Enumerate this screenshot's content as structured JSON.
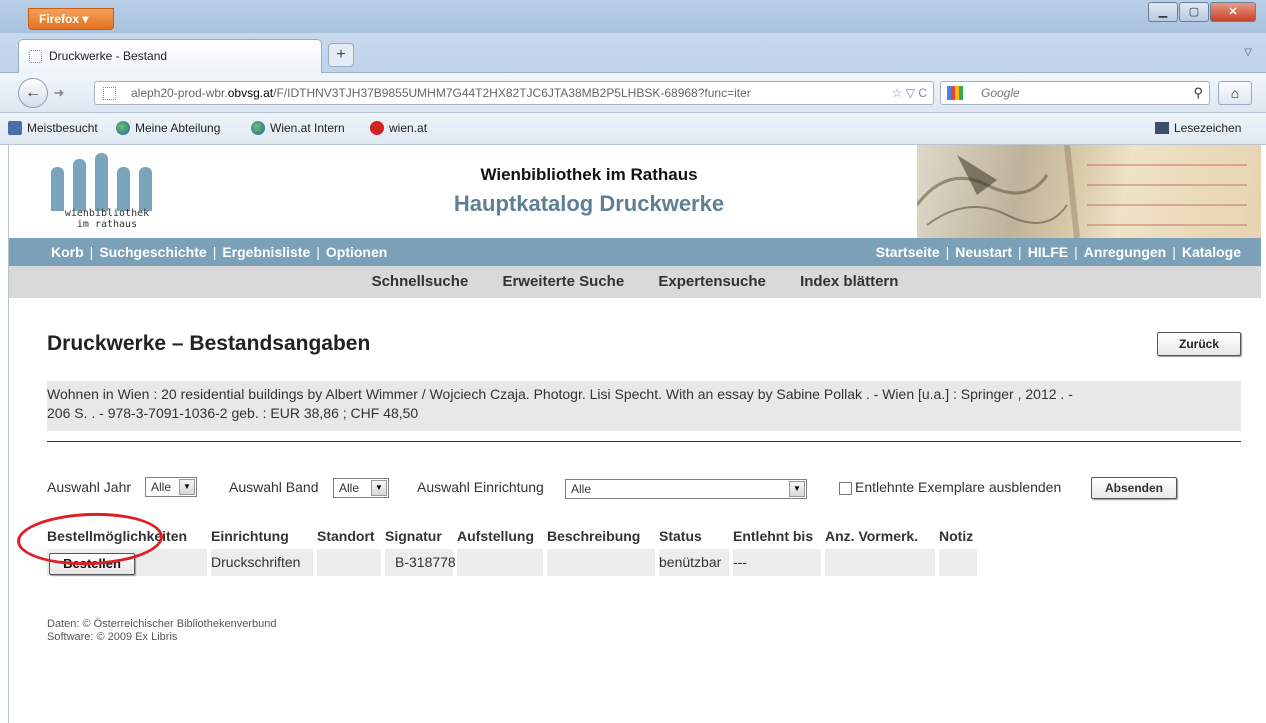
{
  "browser": {
    "menu_label": "Firefox",
    "tab_title": "Druckwerke - Bestand",
    "new_tab": "+",
    "url_prefix": "aleph20-prod-wbr.",
    "url_host": "obvsg.at",
    "url_path": "/F/IDTHNV3TJH37B9855UMHM7G44T2HX82TJC6JTA38MB2P5LHBSK-68968?func=iter",
    "search_placeholder": "Google",
    "bookmarks": [
      {
        "label": "Meistbesucht",
        "icon": "most-visited-icon"
      },
      {
        "label": "Meine Abteilung",
        "icon": "globe-icon"
      },
      {
        "label": "Wien.at Intern",
        "icon": "globe-icon"
      },
      {
        "label": "wien.at",
        "icon": "wien-icon"
      }
    ],
    "bookmarks_menu": "Lesezeichen"
  },
  "header": {
    "logo_line1": "wienbibliothek",
    "logo_line2": "im rathaus",
    "title": "Wienbibliothek im Rathaus",
    "subtitle": "Hauptkatalog Druckwerke",
    "colors": {
      "logo": "#7aa3bc",
      "subtitle": "#5f7f95",
      "nav": "#7ba1b9"
    }
  },
  "topnav": {
    "left": [
      "Korb",
      "Suchgeschichte",
      "Ergebnisliste",
      "Optionen"
    ],
    "right": [
      "Startseite",
      "Neustart",
      "HILFE",
      "Anregungen",
      "Kataloge"
    ]
  },
  "subnav": [
    "Schnellsuche",
    "Erweiterte Suche",
    "Expertensuche",
    "Index blättern"
  ],
  "main": {
    "heading": "Druckwerke – Bestandsangaben",
    "back_button": "Zurück",
    "record_line1": "Wohnen in Wien   : 20 residential buildings by Albert Wimmer  / Wojciech Czaja. Photogr. Lisi Specht. With an essay by Sabine Pollak . - Wien [u.a.]  : Springer , 2012 . -",
    "record_line2": "206 S. . - 978-3-7091-1036-2 geb. : EUR 38,86 ; CHF 48,50"
  },
  "filters": {
    "year_label": "Auswahl Jahr",
    "year_value": "Alle",
    "volume_label": "Auswahl Band",
    "volume_value": "Alle",
    "institution_label": "Auswahl Einrichtung",
    "institution_value": "Alle",
    "hide_loaned_label": "Entlehnte Exemplare ausblenden",
    "submit_label": "Absenden"
  },
  "holdings": {
    "columns": [
      "Bestellmöglichkeiten",
      "Einrichtung",
      "Standort",
      "Signatur",
      "Aufstellung",
      "Beschreibung",
      "Status",
      "Entlehnt bis",
      "Anz. Vormerk.",
      "Notiz"
    ],
    "rows": [
      {
        "order_button": "Bestellen",
        "einrichtung": "Druckschriften",
        "standort": "",
        "signatur": "B-318778",
        "aufstellung": "",
        "beschreibung": "",
        "status": "benützbar",
        "entlehnt_bis": "---",
        "vormerk": "",
        "notiz": ""
      }
    ],
    "highlight_color": "#dd1f26"
  },
  "footer": {
    "line1": "Daten: © Österreichischer Bibliothekenverbund",
    "line2": "Software: © 2009 Ex Libris"
  }
}
